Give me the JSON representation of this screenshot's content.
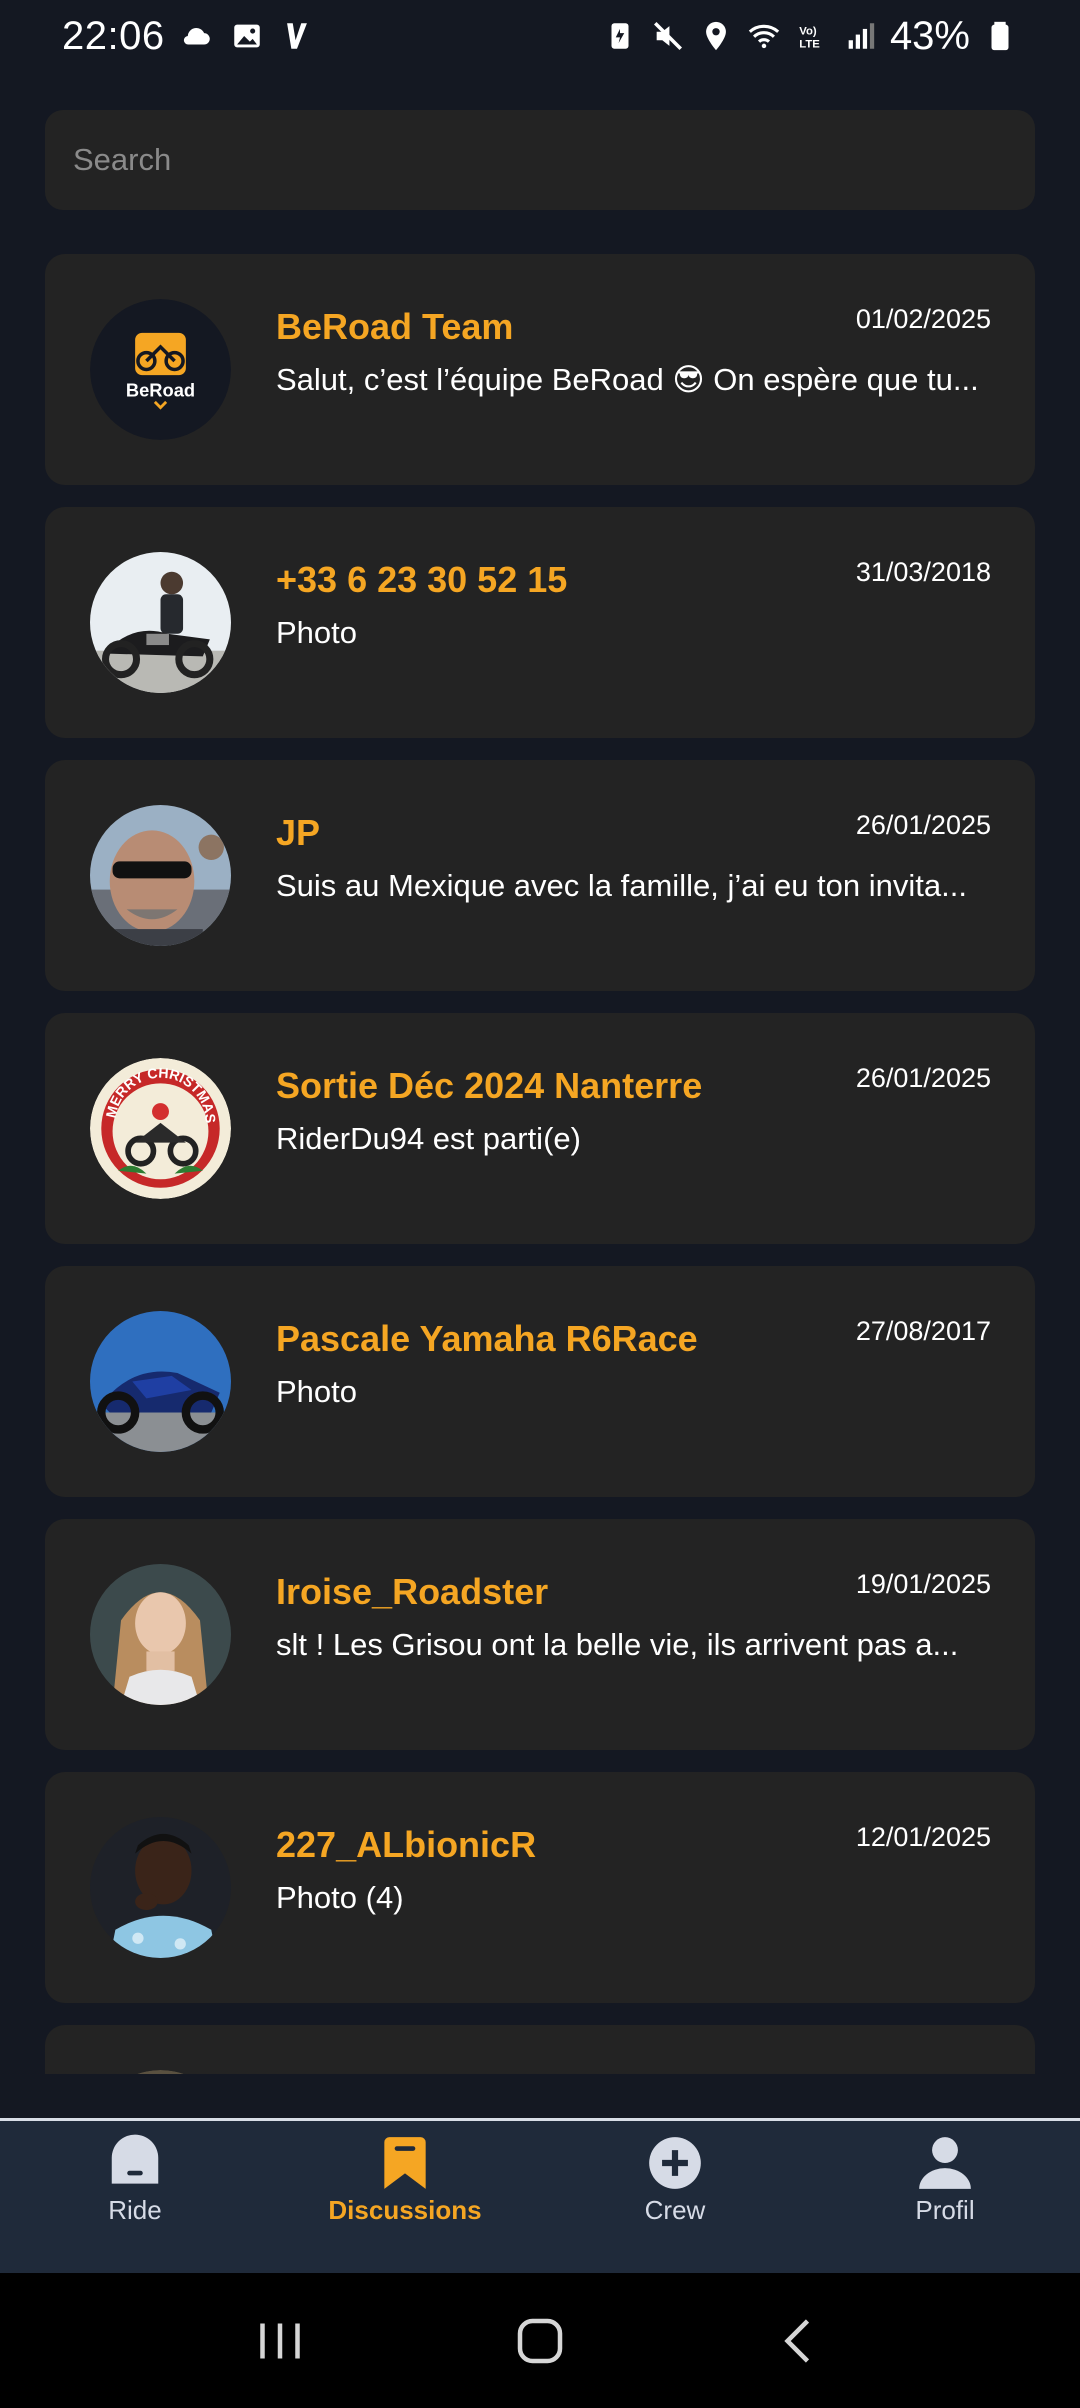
{
  "status": {
    "time": "22:06",
    "battery": "43%",
    "left_icons": [
      "cloud-icon",
      "gallery-icon",
      "v-app-icon"
    ],
    "right_icons": [
      "battery-saver-icon",
      "mute-icon",
      "location-icon",
      "wifi-icon",
      "volte-icon",
      "signal-icon",
      "battery-icon"
    ]
  },
  "search": {
    "placeholder": "Search",
    "value": ""
  },
  "conversations": [
    {
      "name": "BeRoad Team",
      "date": "01/02/2025",
      "message": "Salut, c’est l’équipe BeRoad 😎 On espère que tu...",
      "avatar": "beroad-logo"
    },
    {
      "name": "+33 6 23 30 52 15",
      "date": "31/03/2018",
      "message": "Photo",
      "avatar": "rider-with-motorcycle"
    },
    {
      "name": "JP",
      "date": "26/01/2025",
      "message": "Suis au Mexique avec la famille, j’ai eu ton invita...",
      "avatar": "man-sunglasses"
    },
    {
      "name": "Sortie Déc 2024 Nanterre",
      "date": "26/01/2025",
      "message": "RiderDu94 est parti(e)",
      "avatar": "merry-christmas-badge",
      "avatar_text": "MERRY CHRISTMAS"
    },
    {
      "name": "Pascale Yamaha R6Race",
      "date": "27/08/2017",
      "message": "Photo",
      "avatar": "blue-sportbike"
    },
    {
      "name": "Iroise_Roadster",
      "date": "19/01/2025",
      "message": "slt ! Les Grisou ont la belle vie, ils arrivent pas a...",
      "avatar": "woman-portrait"
    },
    {
      "name": "227_ALbionicR",
      "date": "12/01/2025",
      "message": "Photo (4)",
      "avatar": "man-portrait"
    }
  ],
  "nav": [
    {
      "label": "Ride",
      "icon": "ride-icon",
      "active": false
    },
    {
      "label": "Discussions",
      "icon": "discussions-icon",
      "active": true
    },
    {
      "label": "Crew",
      "icon": "crew-add-icon",
      "active": false
    },
    {
      "label": "Profil",
      "icon": "profile-icon",
      "active": false
    }
  ],
  "colors": {
    "accent": "#f5a623",
    "background": "#141822",
    "card": "#232323",
    "nav": "#1f2a3a"
  },
  "logo_text": "BeRoad"
}
